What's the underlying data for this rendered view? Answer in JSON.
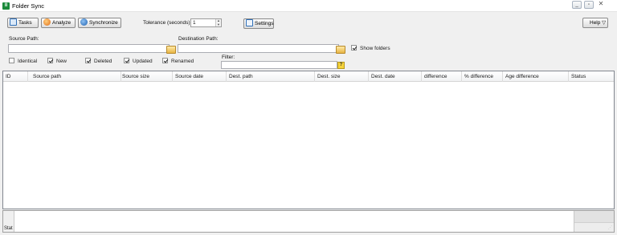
{
  "window": {
    "title": "Folder Sync",
    "controls": [
      "minimize",
      "restore",
      "close"
    ]
  },
  "toolbar": {
    "tasks_label": "Tasks",
    "analyze_label": "Analyze",
    "sync_label": "Synchronize",
    "tolerance_label": "Tolerance (seconds)",
    "tolerance_value": "1",
    "settings_label": "Settings",
    "help_label": "Help ▽"
  },
  "paths": {
    "source_label": "Source Path:",
    "source_value": "",
    "dest_label": "Destination Path:",
    "dest_value": "",
    "show_folders_label": "Show folders",
    "show_folders_checked": true,
    "filter_label": "Filter:",
    "filter_value": ""
  },
  "filters": [
    {
      "label": "Identical",
      "checked": false
    },
    {
      "label": "New",
      "checked": true
    },
    {
      "label": "Deleted",
      "checked": true
    },
    {
      "label": "Updated",
      "checked": true
    },
    {
      "label": "Renamed",
      "checked": true
    }
  ],
  "grid": {
    "columns": [
      "ID",
      "Source path",
      "Source size",
      "Source date",
      "Dest. path",
      "Dest. size",
      "Dest. date",
      "difference",
      "% difference",
      "Age difference",
      "Status"
    ],
    "rows": []
  },
  "status": {
    "label": "Stat"
  },
  "icons": {
    "app": "folder-sync-app-icon",
    "tasks": "tasks-icon",
    "analyze": "analyze-icon",
    "synchronize": "synchronize-icon",
    "settings": "settings-icon",
    "browse": "folder-icon",
    "filter_help": "help-icon"
  }
}
